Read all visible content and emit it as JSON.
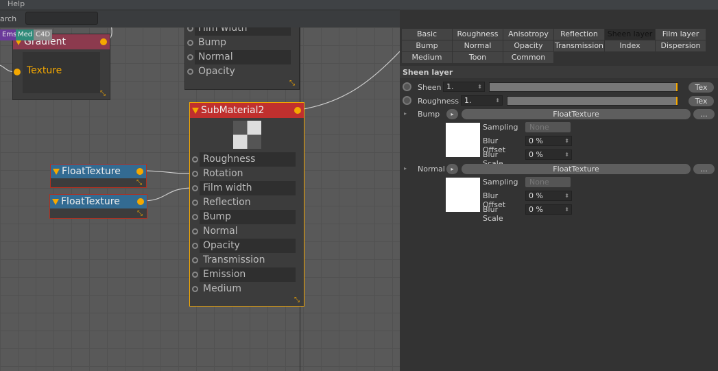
{
  "menu": {
    "help": "Help"
  },
  "search": {
    "label": "arch",
    "value": ""
  },
  "tags": [
    {
      "label": "Ems",
      "color": "#6a3a9a"
    },
    {
      "label": "Med",
      "color": "#2f8b7a"
    },
    {
      "label": "C4D",
      "color": "#8a8a8a"
    }
  ],
  "gradient_node": {
    "title": "Gradient",
    "port": "Texture",
    "color": "#8c3a4e"
  },
  "top_node": {
    "ports": [
      "Film width",
      "Bump",
      "Normal",
      "Opacity"
    ]
  },
  "submaterial_node": {
    "title": "SubMaterial2",
    "color": "#c0302e",
    "ports": [
      "Roughness",
      "Rotation",
      "Film width",
      "Reflection",
      "Bump",
      "Normal",
      "Opacity",
      "Transmission",
      "Emission",
      "Medium"
    ]
  },
  "float_nodes": [
    {
      "title": "FloatTexture"
    },
    {
      "title": "FloatTexture"
    }
  ],
  "tabs": [
    [
      "Basic",
      "Roughness",
      "Anisotropy",
      "Reflection",
      "Sheen layer",
      "Film layer"
    ],
    [
      "Bump",
      "Normal",
      "Opacity",
      "Transmission",
      "Index",
      "Dispersion"
    ],
    [
      "Medium",
      "Toon",
      "Common"
    ]
  ],
  "active_tab": "Sheen layer",
  "section": {
    "title": "Sheen layer",
    "sheen": {
      "label": "Sheen",
      "value": "1.",
      "fraction": 1.0,
      "tex": "Tex"
    },
    "roughness": {
      "label": "Roughness",
      "value": "1.",
      "fraction": 1.0,
      "tex": "Tex"
    },
    "bump": {
      "label": "Bump",
      "texture": "FloatTexture",
      "more": "...",
      "sampling_label": "Sampling",
      "sampling": "None",
      "blur_offset_label": "Blur Offset",
      "blur_offset": "0 %",
      "blur_scale_label": "Blur Scale",
      "blur_scale": "0 %"
    },
    "normal": {
      "label": "Normal",
      "texture": "FloatTexture",
      "more": "...",
      "sampling_label": "Sampling",
      "sampling": "None",
      "blur_offset_label": "Blur Offset",
      "blur_offset": "0 %",
      "blur_scale_label": "Blur Scale",
      "blur_scale": "0 %"
    }
  }
}
